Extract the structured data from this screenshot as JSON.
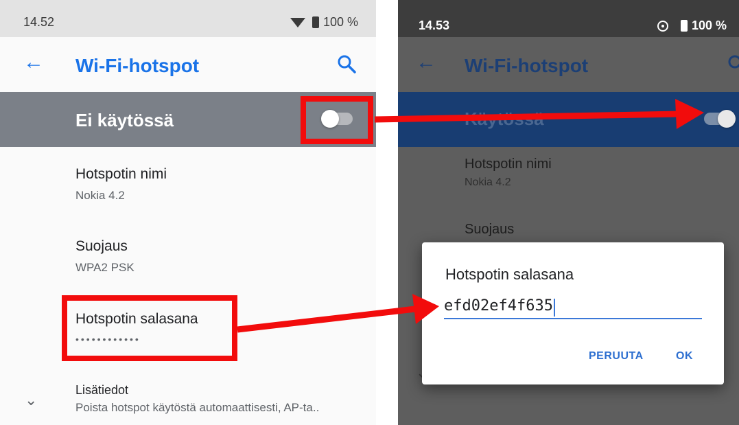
{
  "left": {
    "status": {
      "time": "14.52",
      "battery": "100 %",
      "wifi_icon": "wifi-icon",
      "battery_icon": "battery-icon"
    },
    "appbar": {
      "title": "Wi-Fi-hotspot",
      "back_icon": "arrow-left-icon",
      "search_icon": "search-icon"
    },
    "master_switch": {
      "label": "Ei käytössä",
      "state": "off"
    },
    "items": [
      {
        "label": "Hotspotin nimi",
        "value": "Nokia 4.2"
      },
      {
        "label": "Suojaus",
        "value": "WPA2 PSK"
      },
      {
        "label": "Hotspotin salasana",
        "value": "••••••••••••"
      },
      {
        "label": "Lisätiedot",
        "value": "Poista hotspot käytöstä automaattisesti, AP-ta.."
      }
    ]
  },
  "right": {
    "status": {
      "time": "14.53",
      "battery": "100 %",
      "hotspot_icon": "hotspot-icon",
      "battery_icon": "battery-icon"
    },
    "appbar": {
      "title": "Wi-Fi-hotspot"
    },
    "master_switch": {
      "label": "Käytössä",
      "state": "on"
    },
    "items": [
      {
        "label": "Hotspotin nimi",
        "value": "Nokia 4.2"
      },
      {
        "label": "Suojaus"
      }
    ],
    "dialog": {
      "title": "Hotspotin salasana",
      "password_value": "efd02ef4f635",
      "cancel_label": "PERUUTA",
      "ok_label": "OK"
    }
  },
  "colors": {
    "highlight": "#f20c0c",
    "accent": "#1a73e8",
    "enabled_bar": "#183d72"
  }
}
